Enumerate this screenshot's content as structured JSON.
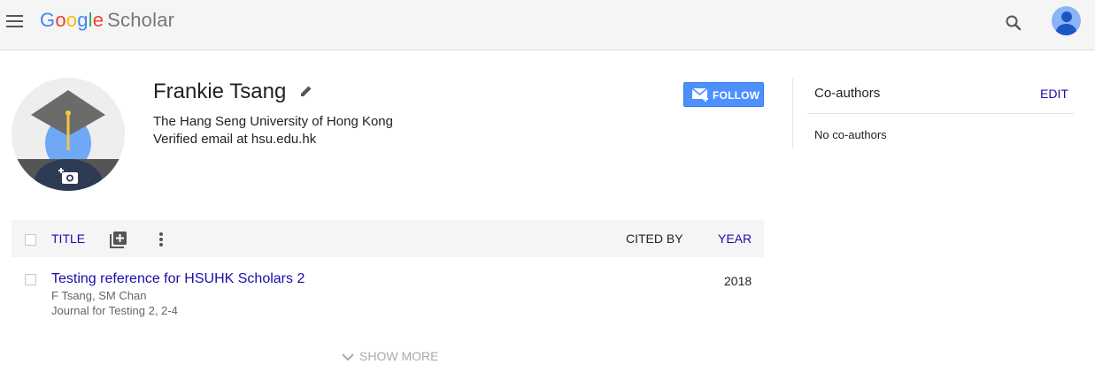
{
  "header": {
    "logo": {
      "g1": "G",
      "g2": "o",
      "g3": "o",
      "g4": "g",
      "g5": "l",
      "g6": "e",
      "scholar": "Scholar"
    },
    "icons": [
      "menu-icon",
      "search-icon",
      "account-icon"
    ]
  },
  "profile": {
    "name": "Frankie Tsang",
    "affiliation": "The Hang Seng University of Hong Kong",
    "email": "Verified email at hsu.edu.hk",
    "follow_label": "FOLLOW"
  },
  "coauthors": {
    "title": "Co-authors",
    "edit_label": "EDIT",
    "empty_text": "No co-authors"
  },
  "table": {
    "headers": {
      "title": "TITLE",
      "cited_by": "CITED BY",
      "year": "YEAR"
    },
    "rows": [
      {
        "title": "Testing reference for HSUHK Scholars 2",
        "authors": "F Tsang, SM Chan",
        "journal": "Journal for Testing 2, 2-4",
        "cited_by": "",
        "year": "2018"
      }
    ],
    "show_more_label": "SHOW MORE"
  },
  "colors": {
    "link": "#1a0dab",
    "follow_button": "#4d90fe",
    "topbar": "#f5f5f5"
  }
}
